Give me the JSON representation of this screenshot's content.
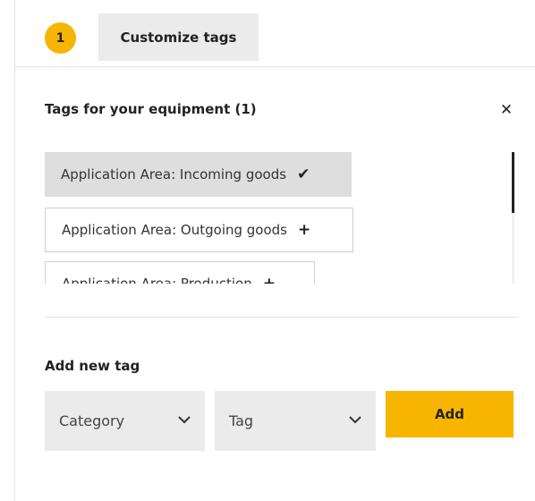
{
  "header": {
    "step_number": "1",
    "tab_label": "Customize tags"
  },
  "panel": {
    "title": "Tags for your equipment (1)",
    "close_icon": "close-icon",
    "tags": [
      {
        "label": "Application Area: Incoming goods",
        "icon": "check-icon",
        "selected": true
      },
      {
        "label": "Application Area: Outgoing goods",
        "icon": "plus-icon",
        "selected": false
      },
      {
        "label": "Application Area: Production",
        "icon": "plus-icon",
        "selected": false
      }
    ]
  },
  "add_new": {
    "title": "Add new tag",
    "category_placeholder": "Category",
    "tag_placeholder": "Tag",
    "add_label": "Add"
  },
  "colors": {
    "accent": "#f7b500",
    "chip_selected": "#dedede",
    "field_bg": "#ebebeb"
  }
}
